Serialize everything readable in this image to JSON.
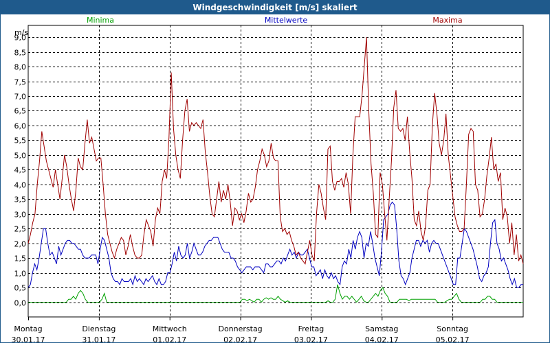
{
  "chart_data": {
    "type": "line",
    "title": "Windgeschwindigkeit [m/s] skaliert",
    "ylabel": "m/s",
    "ylim": [
      -0.5,
      9.4
    ],
    "yticks": [
      "0,0",
      "0,5",
      "1,0",
      "1,5",
      "2,0",
      "2,5",
      "3,0",
      "3,5",
      "4,0",
      "4,5",
      "5,0",
      "5,5",
      "6,0",
      "6,5",
      "7,0",
      "7,5",
      "8,0",
      "8,5",
      "9,0"
    ],
    "ytick_values": [
      0,
      0.5,
      1,
      1.5,
      2,
      2.5,
      3,
      3.5,
      4,
      4.5,
      5,
      5.5,
      6,
      6.5,
      7,
      7.5,
      8,
      8.5,
      9
    ],
    "days": [
      {
        "name": "Montag",
        "date": "30.01.17"
      },
      {
        "name": "Dienstag",
        "date": "31.01.17"
      },
      {
        "name": "Mittwoch",
        "date": "01.02.17"
      },
      {
        "name": "Donnerstag",
        "date": "02.02.17"
      },
      {
        "name": "Freitag",
        "date": "03.02.17"
      },
      {
        "name": "Samstag",
        "date": "04.02.17"
      },
      {
        "name": "Sonntag",
        "date": "05.02.17"
      }
    ],
    "grid": true,
    "legend_placement": "top",
    "series": [
      {
        "name": "Minima",
        "color": "#00a000",
        "values": [
          0,
          0,
          0,
          0,
          0,
          0,
          0,
          0,
          0,
          0,
          0,
          0,
          0,
          0,
          0,
          0,
          0,
          0.1,
          0.1,
          0.2,
          0.1,
          0.3,
          0.4,
          0.3,
          0.1,
          0,
          0,
          0,
          0,
          0,
          0,
          0.1,
          0.3,
          0,
          0,
          0,
          0,
          0,
          0,
          0,
          0,
          0,
          0,
          0,
          0,
          0,
          0,
          0,
          0,
          0,
          0,
          0,
          0,
          0,
          0,
          0,
          0,
          0,
          0,
          0,
          0,
          0,
          0,
          0,
          0,
          0,
          0,
          0,
          0,
          0,
          0,
          0,
          0,
          0,
          0,
          0,
          0,
          0,
          0,
          0,
          0,
          0,
          0,
          0,
          0,
          0,
          0,
          0,
          0,
          0,
          0.1,
          0.1,
          0.05,
          0.1,
          0.05,
          0,
          0.1,
          0.1,
          0,
          0.1,
          0.15,
          0.1,
          0.15,
          0.1,
          0.1,
          0.2,
          0.1,
          0.05,
          0,
          0.05,
          0,
          0,
          0,
          0,
          0,
          0,
          0,
          0,
          0,
          0,
          0,
          0,
          0,
          0,
          0,
          0,
          0.05,
          0,
          0,
          0.1,
          0.6,
          0.3,
          0.1,
          0.2,
          0.2,
          0.1,
          0.2,
          0.1,
          0,
          0.1,
          0.2,
          0.05,
          0,
          0,
          0.1,
          0.2,
          0.3,
          0.2,
          0.4,
          0.5,
          0.3,
          0.2,
          0,
          0,
          0,
          0,
          0.1,
          0.1,
          0.1,
          0.1,
          0.05,
          0.1,
          0.1,
          0.1,
          0.1,
          0.1,
          0.1,
          0.1,
          0.1,
          0.1,
          0.1,
          0.1,
          0,
          0,
          0,
          0,
          0.05,
          0.1,
          0.1,
          0.2,
          0.3,
          0.1,
          0,
          0,
          0,
          0,
          0,
          0,
          0,
          0,
          0,
          0.1,
          0.1,
          0.2,
          0.2,
          0.1,
          0.1,
          0,
          0,
          0,
          0,
          0,
          0,
          0,
          0,
          0,
          0,
          0,
          0
        ]
      },
      {
        "name": "Mittelwerte",
        "color": "#0000c0",
        "values": [
          0.5,
          0.6,
          1.0,
          1.3,
          1.1,
          1.5,
          2.0,
          2.5,
          2.5,
          2.0,
          1.6,
          1.7,
          1.5,
          1.3,
          1.9,
          1.6,
          1.8,
          2.0,
          2.1,
          2.1,
          2.0,
          2.0,
          1.9,
          1.8,
          1.8,
          1.6,
          1.5,
          1.5,
          1.5,
          1.6,
          1.6,
          1.6,
          1.3,
          1.8,
          2.2,
          2.1,
          1.8,
          1.5,
          1.0,
          0.8,
          0.7,
          0.7,
          0.6,
          0.8,
          0.7,
          0.7,
          0.7,
          0.8,
          0.6,
          0.9,
          0.7,
          0.8,
          0.7,
          0.6,
          0.8,
          0.7,
          0.8,
          0.9,
          0.7,
          0.6,
          0.8,
          0.6,
          0.6,
          0.7,
          1.0,
          1.0,
          1.3,
          1.7,
          1.4,
          1.9,
          1.6,
          1.5,
          1.6,
          2.0,
          1.5,
          1.7,
          2.0,
          1.8,
          1.6,
          1.6,
          1.7,
          1.9,
          2.0,
          2.1,
          2.1,
          2.2,
          2.2,
          2.2,
          2.0,
          1.8,
          1.7,
          1.7,
          1.7,
          1.5,
          1.5,
          1.4,
          1.2,
          1.1,
          1.0,
          1.1,
          1.2,
          1.2,
          1.2,
          1.1,
          1.2,
          1.2,
          1.2,
          1.1,
          1.0,
          1.3,
          1.3,
          1.2,
          1.2,
          1.3,
          1.4,
          1.4,
          1.3,
          1.5,
          1.4,
          1.6,
          1.8,
          1.6,
          1.7,
          1.5,
          1.7,
          1.6,
          1.6,
          1.7,
          1.8,
          1.5,
          1.2,
          1.2,
          0.9,
          1.0,
          1.1,
          0.8,
          1.1,
          0.9,
          0.8,
          1.0,
          0.8,
          0.9,
          0.7,
          0.6,
          1.2,
          1.4,
          1.3,
          1.8,
          1.5,
          2.1,
          1.8,
          2.2,
          2.4,
          2.2,
          1.5,
          2.0,
          1.9,
          2.4,
          2.0,
          1.5,
          1.2,
          0.9,
          1.7,
          2.8,
          2.9,
          3.0,
          3.3,
          3.4,
          3.3,
          2.5,
          1.4,
          0.9,
          0.8,
          0.6,
          0.8,
          1.0,
          1.5,
          1.8,
          2.1,
          2.1,
          1.9,
          2.1,
          2.0,
          2.1,
          1.7,
          2.0,
          2.1,
          2.0,
          2.0,
          1.8,
          1.6,
          1.4,
          1.2,
          1.0,
          0.8,
          0.6,
          0.6,
          1.5,
          1.5,
          2.0,
          2.5,
          2.4,
          2.2,
          2.0,
          1.8,
          1.5,
          1.2,
          0.8,
          0.7,
          0.9,
          1.0,
          1.2,
          2.0,
          2.7,
          2.8,
          2.0,
          1.8,
          1.4,
          1.5,
          1.3,
          1.1,
          0.8,
          0.6,
          0.8,
          0.5,
          0.5,
          0.6,
          0.6
        ]
      },
      {
        "name": "Maxima",
        "color": "#a00000",
        "values": [
          2.0,
          2.3,
          2.7,
          3.0,
          4.0,
          4.8,
          5.8,
          5.3,
          4.8,
          4.5,
          4.2,
          3.9,
          4.5,
          4.0,
          3.5,
          4.2,
          5.0,
          4.6,
          4.0,
          3.5,
          3.1,
          3.8,
          4.9,
          4.6,
          4.5,
          5.4,
          6.2,
          5.4,
          5.6,
          5.2,
          4.8,
          4.9,
          4.9,
          4.0,
          3.0,
          2.3,
          2.0,
          1.7,
          1.5,
          1.8,
          2.0,
          2.2,
          2.1,
          1.6,
          1.9,
          2.3,
          1.9,
          1.6,
          1.5,
          1.5,
          1.6,
          2.3,
          2.8,
          2.6,
          2.4,
          1.9,
          2.8,
          3.2,
          3.0,
          4.1,
          4.5,
          4.2,
          5.6,
          7.8,
          5.9,
          5.0,
          4.5,
          4.2,
          5.5,
          6.5,
          6.9,
          5.8,
          6.1,
          6.0,
          6.1,
          6.0,
          5.9,
          6.2,
          5.1,
          4.4,
          3.6,
          3.0,
          2.9,
          3.5,
          4.1,
          3.4,
          3.8,
          3.5,
          4.0,
          3.4,
          2.6,
          3.2,
          3.1,
          2.8,
          3.0,
          2.7,
          3.1,
          3.7,
          3.4,
          3.5,
          3.9,
          4.5,
          4.8,
          5.2,
          5.0,
          4.6,
          4.8,
          5.4,
          4.9,
          4.8,
          4.8,
          2.9,
          2.4,
          2.5,
          2.3,
          2.4,
          2.1,
          1.9,
          1.6,
          1.7,
          1.5,
          1.4,
          1.3,
          1.7,
          2.1,
          1.6,
          1.4,
          3.0,
          4.0,
          3.7,
          3.2,
          2.8,
          5.2,
          5.3,
          4.1,
          3.8,
          4.1,
          4.1,
          4.2,
          3.9,
          4.4,
          4.0,
          3.0,
          5.0,
          6.3,
          6.3,
          6.3,
          7.0,
          8.0,
          9.0,
          6.5,
          4.7,
          3.7,
          2.3,
          2.2,
          4.4,
          4.0,
          3.0,
          2.1,
          3.5,
          4.8,
          6.6,
          7.2,
          5.9,
          5.8,
          5.9,
          5.5,
          6.3,
          5.1,
          4.2,
          2.8,
          2.6,
          3.1,
          2.4,
          2.1,
          2.6,
          3.8,
          4.0,
          6.0,
          7.1,
          6.4,
          5.4,
          5.0,
          5.5,
          6.4,
          5.0,
          4.3,
          3.6,
          2.9,
          2.6,
          2.4,
          2.4,
          2.5,
          4.0,
          5.7,
          5.9,
          5.8,
          4.0,
          3.8,
          2.9,
          3.0,
          3.5,
          4.3,
          4.9,
          5.6,
          4.5,
          4.7,
          4.1,
          4.4,
          2.8,
          3.2,
          2.9,
          2.0,
          2.7,
          1.6,
          2.3,
          1.4,
          1.6,
          1.3
        ]
      }
    ]
  }
}
